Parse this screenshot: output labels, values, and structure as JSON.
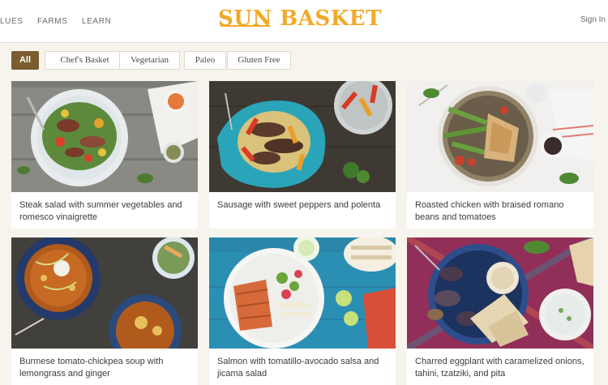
{
  "header": {
    "nav": [
      "LUES",
      "FARMS",
      "LEARN"
    ],
    "logo_part1": "SUN",
    "logo_part2": " BASKET",
    "signin": "Sign In"
  },
  "filters": [
    "All",
    "Chef's Basket",
    "Vegetarian",
    "Paleo",
    "Gluten Free"
  ],
  "active_filter": "All",
  "recipes": [
    {
      "title": "Steak salad with summer vegetables and romesco vinaigrette"
    },
    {
      "title": "Sausage with sweet peppers and polenta"
    },
    {
      "title": "Roasted chicken with braised romano beans and tomatoes"
    },
    {
      "title": "Burmese tomato-chickpea soup with lemongrass and ginger"
    },
    {
      "title": "Salmon with tomatillo-avocado salsa and jicama salad"
    },
    {
      "title": "Charred eggplant with caramelized onions, tahini, tzatziki, and pita"
    }
  ],
  "colors": {
    "accent": "#f2a927",
    "active_chip": "#7a5c2e",
    "background": "#f7f4ee"
  }
}
